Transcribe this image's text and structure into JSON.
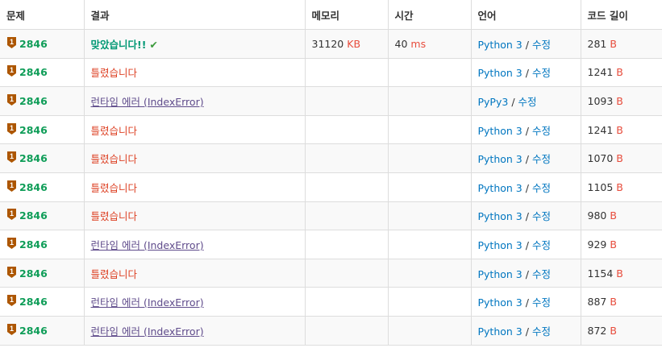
{
  "headers": {
    "problem": "문제",
    "result": "결과",
    "memory": "메모리",
    "time": "시간",
    "language": "언어",
    "code_length": "코드 길이"
  },
  "units": {
    "memory": "KB",
    "time": "ms",
    "code": "B"
  },
  "separator": "/",
  "colors": {
    "problem_link": "#0f9d58",
    "accepted": "#009874",
    "wrong": "#dd4124",
    "runtime_error": "#5f4b8b",
    "language_link": "#0076c0",
    "unit": "#e74c3c",
    "tier_badge": "#ad5600"
  },
  "rows": [
    {
      "problem": "2846",
      "tier_icon": "bronze-tier-icon",
      "result": "맞았습니다!!",
      "result_type": "accepted",
      "memory": "31120",
      "time": "40",
      "language": "Python 3",
      "edit": "수정",
      "code_length": "281"
    },
    {
      "problem": "2846",
      "tier_icon": "bronze-tier-icon",
      "result": "틀렸습니다",
      "result_type": "wrong",
      "memory": "",
      "time": "",
      "language": "Python 3",
      "edit": "수정",
      "code_length": "1241"
    },
    {
      "problem": "2846",
      "tier_icon": "bronze-tier-icon",
      "result": "런타임 에러 (IndexError)",
      "result_type": "runtime-error",
      "memory": "",
      "time": "",
      "language": "PyPy3",
      "edit": "수정",
      "code_length": "1093"
    },
    {
      "problem": "2846",
      "tier_icon": "bronze-tier-icon",
      "result": "틀렸습니다",
      "result_type": "wrong",
      "memory": "",
      "time": "",
      "language": "Python 3",
      "edit": "수정",
      "code_length": "1241"
    },
    {
      "problem": "2846",
      "tier_icon": "bronze-tier-icon",
      "result": "틀렸습니다",
      "result_type": "wrong",
      "memory": "",
      "time": "",
      "language": "Python 3",
      "edit": "수정",
      "code_length": "1070"
    },
    {
      "problem": "2846",
      "tier_icon": "bronze-tier-icon",
      "result": "틀렸습니다",
      "result_type": "wrong",
      "memory": "",
      "time": "",
      "language": "Python 3",
      "edit": "수정",
      "code_length": "1105"
    },
    {
      "problem": "2846",
      "tier_icon": "bronze-tier-icon",
      "result": "틀렸습니다",
      "result_type": "wrong",
      "memory": "",
      "time": "",
      "language": "Python 3",
      "edit": "수정",
      "code_length": "980"
    },
    {
      "problem": "2846",
      "tier_icon": "bronze-tier-icon",
      "result": "런타임 에러 (IndexError)",
      "result_type": "runtime-error",
      "memory": "",
      "time": "",
      "language": "Python 3",
      "edit": "수정",
      "code_length": "929"
    },
    {
      "problem": "2846",
      "tier_icon": "bronze-tier-icon",
      "result": "틀렸습니다",
      "result_type": "wrong",
      "memory": "",
      "time": "",
      "language": "Python 3",
      "edit": "수정",
      "code_length": "1154"
    },
    {
      "problem": "2846",
      "tier_icon": "bronze-tier-icon",
      "result": "런타임 에러 (IndexError)",
      "result_type": "runtime-error",
      "memory": "",
      "time": "",
      "language": "Python 3",
      "edit": "수정",
      "code_length": "887"
    },
    {
      "problem": "2846",
      "tier_icon": "bronze-tier-icon",
      "result": "런타임 에러 (IndexError)",
      "result_type": "runtime-error",
      "memory": "",
      "time": "",
      "language": "Python 3",
      "edit": "수정",
      "code_length": "872"
    }
  ]
}
